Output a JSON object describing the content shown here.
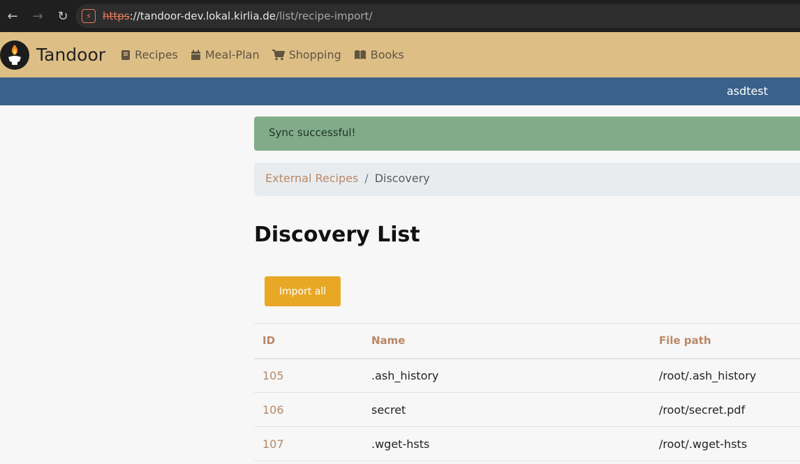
{
  "browser": {
    "url_scheme": "https",
    "url_host": "://tandoor-dev.lokal.kirlia.de",
    "url_path": "/list/recipe-import/"
  },
  "navbar": {
    "brand": "Tandoor",
    "links": [
      {
        "label": "Recipes",
        "icon": "book-icon"
      },
      {
        "label": "Meal-Plan",
        "icon": "calendar-icon"
      },
      {
        "label": "Shopping",
        "icon": "cart-icon"
      },
      {
        "label": "Books",
        "icon": "open-book-icon"
      }
    ]
  },
  "userbar": {
    "username": "asdtest"
  },
  "alert": {
    "message": "Sync successful!"
  },
  "breadcrumb": {
    "link": "External Recipes",
    "separator": "/",
    "active": "Discovery"
  },
  "page": {
    "title": "Discovery List",
    "import_all_label": "Import all"
  },
  "table": {
    "headers": [
      "ID",
      "Name",
      "File path"
    ],
    "rows": [
      {
        "id": "105",
        "name": ".ash_history",
        "path": "/root/.ash_history"
      },
      {
        "id": "106",
        "name": "secret",
        "path": "/root/secret.pdf"
      },
      {
        "id": "107",
        "name": ".wget-hsts",
        "path": "/root/.wget-hsts"
      }
    ]
  },
  "colors": {
    "navbar_bg": "#ddbf86",
    "userbar_bg": "#3a6189",
    "alert_bg": "#82ab8a",
    "accent": "#b98766",
    "button_bg": "#e8a826"
  }
}
